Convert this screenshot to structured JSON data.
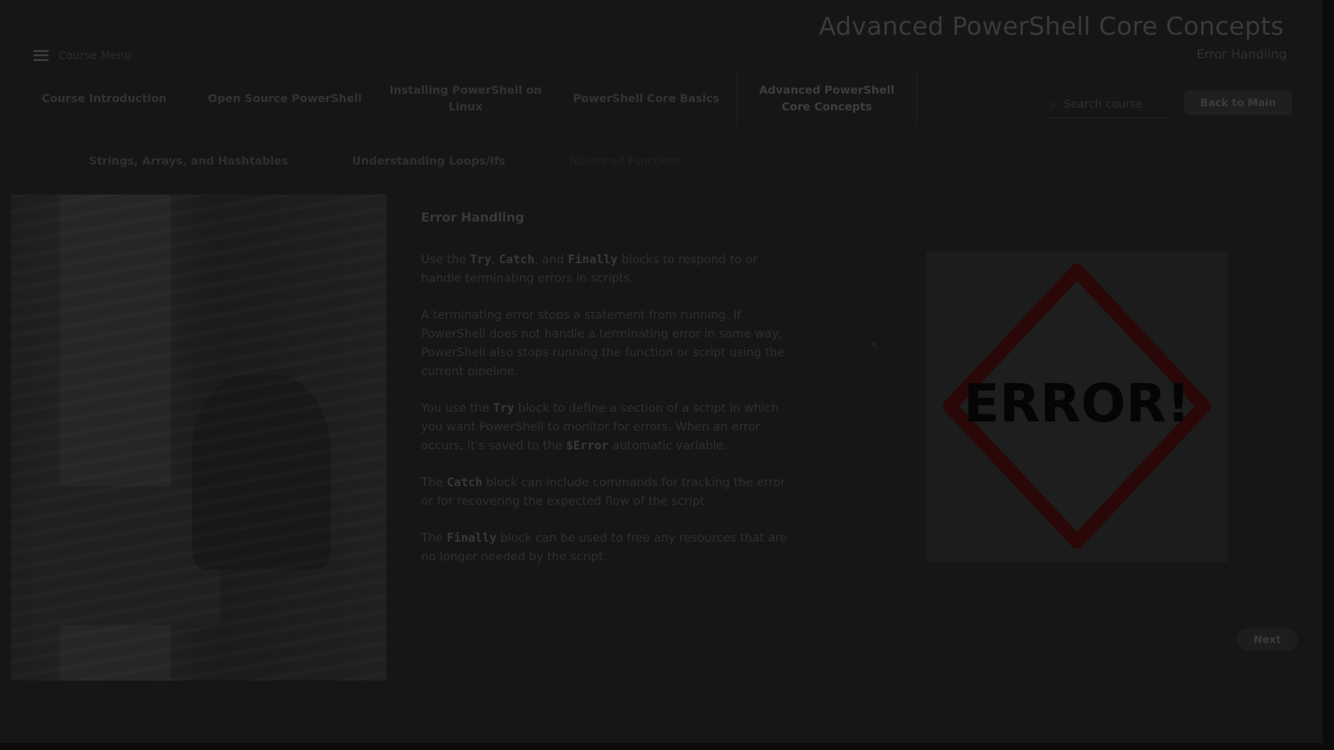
{
  "header": {
    "course_title": "Advanced PowerShell Core Concepts",
    "course_subtitle": "Error Handling",
    "menu_label": "Course Menu"
  },
  "topnav": {
    "items": [
      {
        "label": "Course Introduction"
      },
      {
        "label": "Open Source PowerShell"
      },
      {
        "label": "Installing PowerShell on Linux"
      },
      {
        "label": "PowerShell Core Basics"
      },
      {
        "label": "Advanced PowerShell Core Concepts",
        "active": true
      }
    ],
    "search_placeholder": "Search course",
    "back_label": "Back to Main"
  },
  "subnav": {
    "items": [
      "Strings, Arrays, and Hashtables",
      "Understanding Loops/Ifs",
      "Advanced Functions"
    ]
  },
  "lesson": {
    "heading": "Error Handling",
    "p1": {
      "a": "Use the ",
      "b": "Try",
      "c": ", ",
      "d": "Catch",
      "e": ", and ",
      "f": "Finally",
      "g": " blocks to respond to or handle terminating errors in scripts."
    },
    "p2": "A terminating error stops a statement from running. If PowerShell does not handle a terminating error in some way, PowerShell also stops running the function or script using the current pipeline.",
    "p3": {
      "a": "You use the ",
      "b": "Try",
      "c": " block to define a section of a script in which you want PowerShell to monitor for errors. When an error occurs, it's saved to the ",
      "d": "$Error",
      "e": " automatic variable."
    },
    "p4": {
      "a": "The ",
      "b": "Catch",
      "c": " block can include commands for tracking the error or for recovering the expected flow of the script."
    },
    "p5": {
      "a": "The ",
      "b": "Finally",
      "c": " block can be used to free any resources that are no longer needed by the script."
    }
  },
  "error_image": {
    "sign_text": "ERROR!"
  },
  "next_label": "Next"
}
